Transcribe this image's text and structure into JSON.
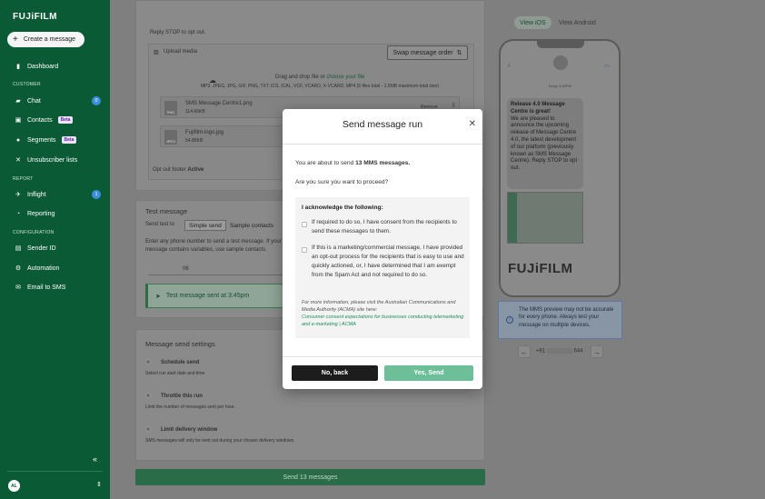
{
  "sidebar": {
    "logo": "FUJiFILM",
    "create_button": "Create a message",
    "sections": {
      "customer": "CUSTOMER",
      "report": "REPORT",
      "configuration": "CONFIGURATION"
    },
    "items": {
      "dashboard": "Dashboard",
      "chat": "Chat",
      "chat_count": "0",
      "contacts": "Contacts",
      "segments": "Segments",
      "unsubscriber": "Unsubscriber lists",
      "inflight": "Inflight",
      "inflight_count": "1",
      "reporting": "Reporting",
      "sender_id": "Sender ID",
      "automation": "Automation",
      "email_to_sms": "Email to SMS"
    },
    "beta_label": "Beta",
    "user_initials": "AL"
  },
  "composer": {
    "optout_line": "Reply STOP to opt out.",
    "upload_label": "Upload media",
    "swap_button": "Swap message order",
    "drag_text": "Drag and drop file or",
    "choose_file": "choose your file",
    "formats": "MP3, JPEG, JPG, GIF, PNG, TXT, ICS, ICAL, VCF, VCARD, X-VCARD, MP4 (5 files total - 1.5MB maximum total size)",
    "files": [
      {
        "name": "SMS Message Centre1.png",
        "size": "114.66KB",
        "ext": "PNG",
        "action": "Remove"
      },
      {
        "name": "Fujifilm-logo.jpg",
        "size": "54.85KB",
        "ext": "JPEG"
      }
    ],
    "optout_footer_label": "Opt out footer",
    "optout_footer_value": "Active"
  },
  "test_message": {
    "title": "Test message",
    "send_test_to": "Send test to",
    "tab_simple": "Simple send",
    "tab_sample": "Sample contacts",
    "help": "Enter any phone number to send a test message. If your message contains variables, use sample contacts.",
    "phone_value": "06",
    "toast": "Test message sent at 3:45pm"
  },
  "settings": {
    "title": "Message send settings",
    "options": [
      {
        "label": "Schedule send",
        "desc": "Select run start date and time"
      },
      {
        "label": "Throttle this run",
        "desc": "Limit the number of messages sent per hour."
      },
      {
        "label": "Limit delivery window",
        "desc": "SMS messages will only be sent out during your chosen delivery windows."
      }
    ]
  },
  "send_button": "Send 13 messages",
  "preview": {
    "tab_ios": "View iOS",
    "tab_android": "View Android",
    "time": "Today 3:45PM",
    "message_title": "Release 4.0 Message Centre is great!",
    "message_body": "We are pleased to announce the upcoming release of Message Centre 4.0, the latest development of our platform (previously known as SMS Message Centre). Reply STOP to opt out.",
    "logo": "FUJiFILM",
    "info": "The MMS preview may not be accurate for every phone. Always test your message on multiple devices.",
    "number_prefix": "+61",
    "number_suffix": "644"
  },
  "modal": {
    "title": "Send message run",
    "intro_prefix": "You are about to send ",
    "intro_count": "13 MMS messages.",
    "confirm_q": "Are you sure you want to proceed?",
    "ack_title": "I acknowledge the following:",
    "ack_items": [
      "If required to do so, I have consent from the recipients to send these messages to them.",
      "If this is a marketing/commercial message, I have provided an opt-out process for the recipients that is easy to use and quickly actioned, or, I have determined that I am exempt from the Spam Act and not required to do so."
    ],
    "note": "For more information, please visit the Australian Communications and Media Authority (ACMA) site here:",
    "note_link": "Consumer consent expectations for businesses conducting telemarketing and e-marketing | ACMA",
    "btn_no": "No, back",
    "btn_yes": "Yes, Send"
  },
  "colors": {
    "sidebar_bg": "#0b5a36",
    "accent_green": "#6dbf9a",
    "link_green": "#1a8f5a",
    "badge_blue": "#3a8edb"
  }
}
